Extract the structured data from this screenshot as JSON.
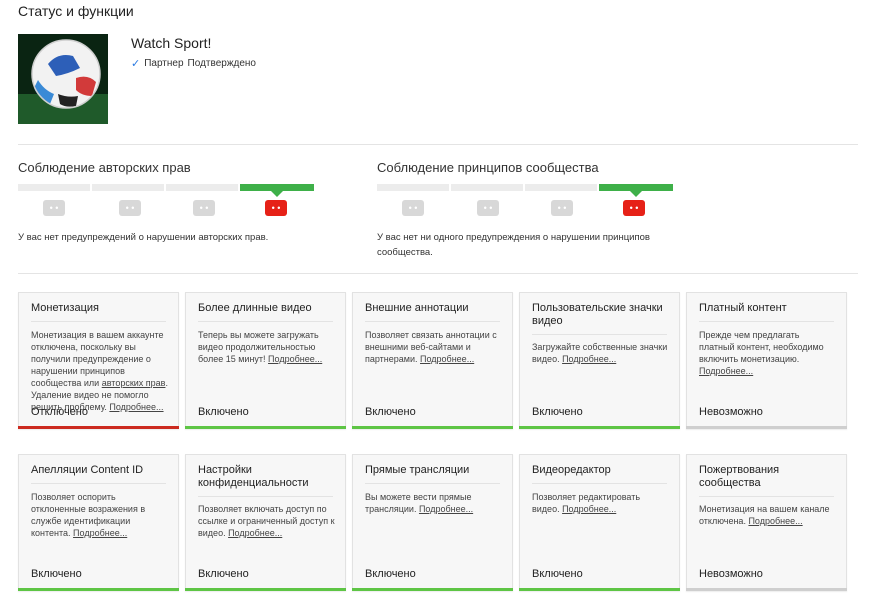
{
  "page": {
    "title": "Статус и функции"
  },
  "channel": {
    "name": "Watch Sport!",
    "partner_label": "Партнер",
    "partner_status": "Подтверждено"
  },
  "copyright": {
    "title": "Соблюдение авторских прав",
    "text": "У вас нет предупреждений о нарушении авторских прав.",
    "active_level": 4
  },
  "community": {
    "title": "Соблюдение принципов сообщества",
    "text": "У вас нет ни одного предупреждения о нарушении принципов сообщества.",
    "active_level": 4
  },
  "link_more": "Подробнее...",
  "colors": {
    "enabled": "#5ec545",
    "disabled": "#cc2a1f",
    "impossible": "#cfcfcf",
    "face_active": "#e62117"
  },
  "features": [
    {
      "title": "Монетизация",
      "desc_before": "Монетизация в вашем аккаунте отключена, поскольку вы получили предупреждение о нарушении принципов сообщества или ",
      "desc_link1": "авторских прав",
      "desc_after": ". Удаление видео не помогло решить проблему. ",
      "status": "Отключено"
    },
    {
      "title": "Более длинные видео",
      "desc": "Теперь вы можете загружать видео продолжительностью более 15 минут! ",
      "status": "Включено"
    },
    {
      "title": "Внешние аннотации",
      "desc": "Позволяет связать аннотации с внешними веб-сайтами и партнерами. ",
      "status": "Включено"
    },
    {
      "title": "Пользовательские значки видео",
      "desc": "Загружайте собственные значки видео. ",
      "status": "Включено"
    },
    {
      "title": "Платный контент",
      "desc": "Прежде чем предлагать платный контент, необходимо включить монетизацию. ",
      "status": "Невозможно"
    },
    {
      "title": "Апелляции Content ID",
      "desc": "Позволяет оспорить отклоненные возражения в службе идентификации контента. ",
      "status": "Включено"
    },
    {
      "title": "Настройки конфиденциальности",
      "desc": "Позволяет включать доступ по ссылке и ограниченный доступ к видео. ",
      "status": "Включено"
    },
    {
      "title": "Прямые трансляции",
      "desc": "Вы можете вести прямые трансляции. ",
      "status": "Включено"
    },
    {
      "title": "Видеоредактор",
      "desc": "Позволяет редактировать видео. ",
      "status": "Включено"
    },
    {
      "title": "Пожертвования сообщества",
      "desc": "Монетизация на вашем канале отключена. ",
      "status": "Невозможно"
    }
  ]
}
